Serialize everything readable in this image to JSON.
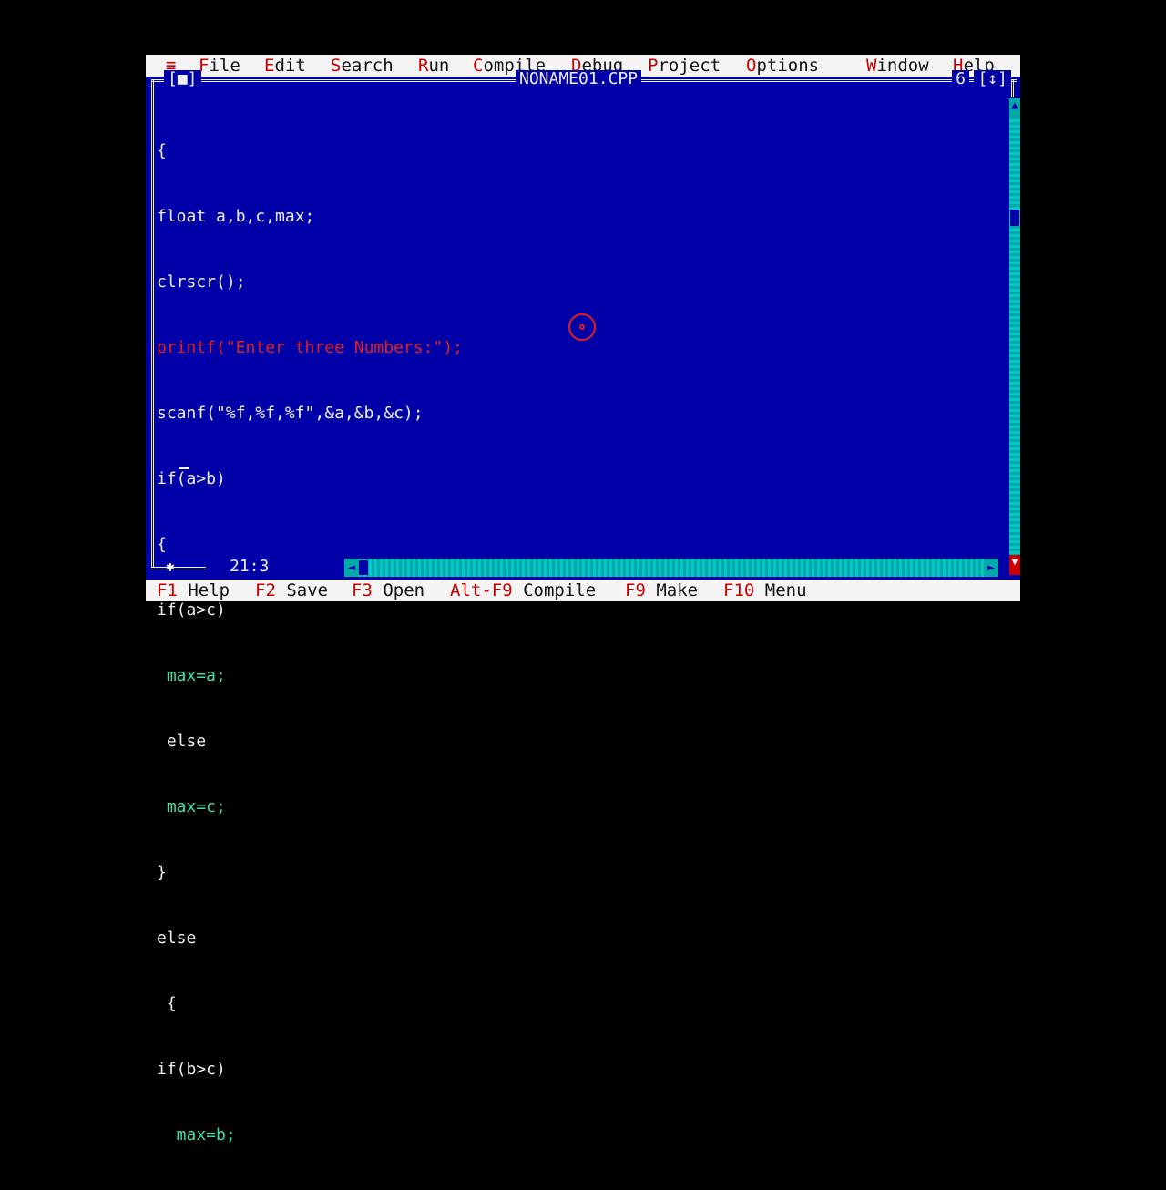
{
  "menu": {
    "system": "≡",
    "items": [
      {
        "hot": "F",
        "rest": "ile"
      },
      {
        "hot": "E",
        "rest": "dit"
      },
      {
        "hot": "S",
        "rest": "earch"
      },
      {
        "hot": "R",
        "rest": "un"
      },
      {
        "hot": "C",
        "rest": "ompile"
      },
      {
        "hot": "D",
        "rest": "ebug"
      },
      {
        "hot": "P",
        "rest": "roject"
      },
      {
        "hot": "O",
        "rest": "ptions"
      },
      {
        "hot": "W",
        "rest": "indow"
      },
      {
        "hot": "H",
        "rest": "elp"
      }
    ]
  },
  "window": {
    "title": "NONAME01.CPP",
    "number": "6",
    "close_box": "[■]",
    "zoom_box": "[↕]",
    "cursor_position": "21:3"
  },
  "code": [
    "{",
    "float a,b,c,max;",
    "clrscr();",
    "printf(\"Enter three Numbers:\");",
    "scanf(\"%f,%f,%f\",&a,&b,&c);",
    "if(a>b)",
    "{",
    "if(a>c)",
    " max=a;",
    " else",
    " max=c;",
    "}",
    "else",
    " {",
    "if(b>c)",
    "  max=b;"
  ],
  "help_line": [
    {
      "key": "F1",
      "label": "Help"
    },
    {
      "key": "F2",
      "label": "Save"
    },
    {
      "key": "F3",
      "label": "Open"
    },
    {
      "key": "Alt-F9",
      "label": "Compile"
    },
    {
      "key": "F9",
      "label": "Make"
    },
    {
      "key": "F10",
      "label": "Menu"
    }
  ],
  "colors": {
    "background": "#0000a8",
    "menu_bg": "#f4f4f4",
    "hotkey": "#c80000",
    "string": "#e02020",
    "scrollbar": "#00a8a8"
  }
}
